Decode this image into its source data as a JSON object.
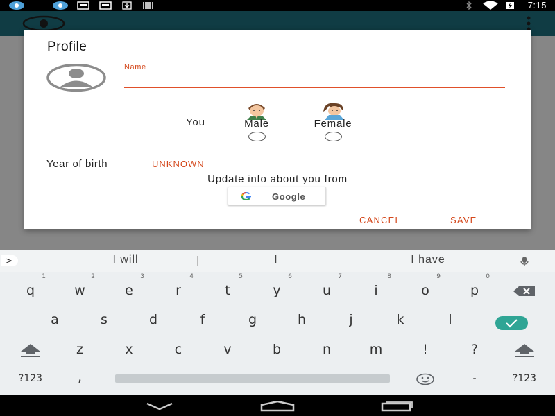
{
  "status_bar": {
    "time": "7:15",
    "icons": [
      "app-notification-icon",
      "app-notification-icon",
      "message-icon",
      "message-icon",
      "download-icon",
      "barcode-icon",
      "bluetooth-icon",
      "wifi-icon",
      "battery-charging-icon"
    ]
  },
  "dialog": {
    "title": "Profile",
    "name_label": "Name",
    "name_value": "",
    "you_label": "You",
    "gender_options": [
      {
        "label": "Male",
        "selected": false
      },
      {
        "label": "Female",
        "selected": false
      }
    ],
    "year_of_birth_label": "Year of birth",
    "year_of_birth_value": "UNKNOWN",
    "update_text": "Update info about you from",
    "google_button_label": "Google",
    "cancel_label": "CANCEL",
    "save_label": "SAVE"
  },
  "keyboard": {
    "suggestions": [
      "I will",
      "I",
      "I have"
    ],
    "suggestions_arrow": ">",
    "row1": [
      {
        "key": "q",
        "hint": "1"
      },
      {
        "key": "w",
        "hint": "2"
      },
      {
        "key": "e",
        "hint": "3"
      },
      {
        "key": "r",
        "hint": "4"
      },
      {
        "key": "t",
        "hint": "5"
      },
      {
        "key": "y",
        "hint": "6"
      },
      {
        "key": "u",
        "hint": "7"
      },
      {
        "key": "i",
        "hint": "8"
      },
      {
        "key": "o",
        "hint": "9"
      },
      {
        "key": "p",
        "hint": "0"
      }
    ],
    "row2": [
      "a",
      "s",
      "d",
      "f",
      "g",
      "h",
      "j",
      "k",
      "l"
    ],
    "row3": [
      "z",
      "x",
      "c",
      "v",
      "b",
      "n",
      "m",
      "!",
      "?"
    ],
    "row4": {
      "symbols_left": "?123",
      "comma": ",",
      "dash": "-",
      "symbols_right": "?123"
    },
    "accent_color": "#2fa595"
  },
  "colors": {
    "accent": "#d4481c",
    "appbar": "#1e6e7c"
  }
}
